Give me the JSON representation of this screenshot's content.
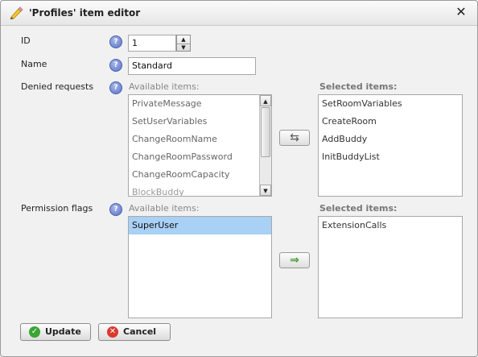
{
  "dialog": {
    "title": "'Profiles' item editor",
    "close_symbol": "✕"
  },
  "fields": {
    "id_label": "ID",
    "id_value": "1",
    "name_label": "Name",
    "name_value": "Standard",
    "denied_label": "Denied requests",
    "flags_label": "Permission flags",
    "help_symbol": "?"
  },
  "denied": {
    "available_head": "Available items:",
    "selected_head": "Selected items:",
    "available": [
      "PrivateMessage",
      "SetUserVariables",
      "ChangeRoomName",
      "ChangeRoomPassword",
      "ChangeRoomCapacity",
      "BlockBuddy"
    ],
    "selected": [
      "SetRoomVariables",
      "CreateRoom",
      "AddBuddy",
      "InitBuddyList"
    ],
    "move_symbol": "⇆"
  },
  "flags": {
    "available_head": "Available items:",
    "selected_head": "Selected items:",
    "available": [
      "SuperUser"
    ],
    "selected": [
      "ExtensionCalls"
    ],
    "move_symbol": "⇒"
  },
  "buttons": {
    "update": "Update",
    "cancel": "Cancel"
  },
  "icons": {
    "title": "pencil-icon",
    "update": "check-icon",
    "cancel": "cancel-icon"
  },
  "colors": {
    "selection": "#a9d0f5",
    "update_icon": "#3aa535",
    "cancel_icon": "#d93a2e",
    "arrow_green": "#3c9a2a"
  }
}
